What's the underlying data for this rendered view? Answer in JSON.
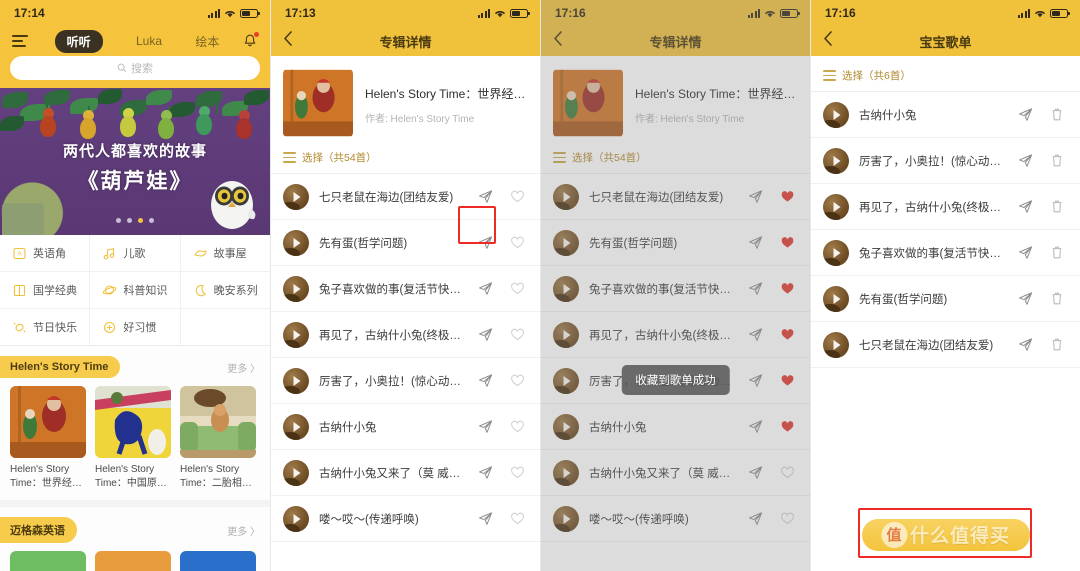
{
  "panels": {
    "home": {
      "status": {
        "time": "17:14"
      },
      "nav": {
        "menu_icon": "hamburger-icon",
        "tabs": [
          {
            "label": "听听",
            "active": true
          },
          {
            "label": "Luka",
            "active": false
          },
          {
            "label": "绘本",
            "active": false
          }
        ],
        "bell_icon": "bell-icon"
      },
      "search": {
        "placeholder": "搜索",
        "icon": "search-icon"
      },
      "hero": {
        "line1": "两代人都喜欢的故事",
        "line2": "《葫芦娃》",
        "dots": 4,
        "active_dot": 2
      },
      "categories": [
        [
          {
            "label": "英语角",
            "icon": "card-icon"
          },
          {
            "label": "儿歌",
            "icon": "music-note-icon"
          },
          {
            "label": "故事屋",
            "icon": "house-icon"
          }
        ],
        [
          {
            "label": "国学经典",
            "icon": "book-icon"
          },
          {
            "label": "科普知识",
            "icon": "planet-icon"
          },
          {
            "label": "晚安系列",
            "icon": "moon-icon"
          }
        ],
        [
          {
            "label": "节日快乐",
            "icon": "candy-icon"
          },
          {
            "label": "好习惯",
            "icon": "plus-circle-icon"
          },
          {
            "label": "",
            "icon": ""
          }
        ]
      ],
      "sections": [
        {
          "tag": "Helen's Story Time",
          "more": "更多 〉",
          "cards": [
            {
              "caption": "Helen's Story Time：世界经…"
            },
            {
              "caption": "Helen's Story Time：中国原…"
            },
            {
              "caption": "Helen's Story Time：二胎相…"
            }
          ]
        },
        {
          "tag": "迈格森英语",
          "more": "更多 〉",
          "cards": [
            {
              "caption": ""
            },
            {
              "caption": ""
            },
            {
              "caption": ""
            }
          ]
        }
      ]
    },
    "album_plain": {
      "status": {
        "time": "17:13"
      },
      "title": "专辑详情",
      "back_icon": "chevron-left-icon",
      "album": {
        "name": "Helen's Story Time：世界经…",
        "author": "作者: Helen's Story Time"
      },
      "select": {
        "label": "选择（共54首）",
        "icon": "list-icon"
      },
      "tracks": [
        {
          "name": "七只老鼠在海边(团结友爱)",
          "fav": false
        },
        {
          "name": "先有蛋(哲学问题)",
          "fav": false
        },
        {
          "name": "兔子喜欢做的事(复活节快…",
          "fav": false
        },
        {
          "name": "再见了，古纳什小兔(终极…",
          "fav": false
        },
        {
          "name": "厉害了，小奥拉！(惊心动…",
          "fav": false
        },
        {
          "name": "古纳什小兔",
          "fav": false
        },
        {
          "name": "古纳什小兔又来了（莫 威…",
          "fav": false
        },
        {
          "name": "喽～哎～(传递呼唤)",
          "fav": false
        }
      ],
      "highlight": "send-icon on first track"
    },
    "album_faved": {
      "status": {
        "time": "17:16"
      },
      "title": "专辑详情",
      "back_icon": "chevron-left-icon",
      "album": {
        "name": "Helen's Story Time：世界经…",
        "author": "作者: Helen's Story Time"
      },
      "select": {
        "label": "选择（共54首）",
        "icon": "list-icon"
      },
      "toast": "收藏到歌单成功",
      "tracks": [
        {
          "name": "七只老鼠在海边(团结友爱)",
          "fav": true
        },
        {
          "name": "先有蛋(哲学问题)",
          "fav": true
        },
        {
          "name": "兔子喜欢做的事(复活节快…",
          "fav": true
        },
        {
          "name": "再见了，古纳什小兔(终极…",
          "fav": true
        },
        {
          "name": "厉害了，小奥拉！(惊心动…",
          "fav": true
        },
        {
          "name": "古纳什小兔",
          "fav": true
        },
        {
          "name": "古纳什小兔又来了（莫 威…",
          "fav": false
        },
        {
          "name": "喽～哎～(传递呼唤)",
          "fav": false
        }
      ]
    },
    "playlist": {
      "status": {
        "time": "17:16"
      },
      "title": "宝宝歌单",
      "back_icon": "chevron-left-icon",
      "select": {
        "label": "选择（共6首）",
        "icon": "list-icon"
      },
      "tracks": [
        {
          "name": "古纳什小兔"
        },
        {
          "name": "厉害了，小奥拉！(惊心动…"
        },
        {
          "name": "再见了，古纳什小兔(终极…"
        },
        {
          "name": "兔子喜欢做的事(复活节快…"
        },
        {
          "name": "先有蛋(哲学问题)"
        },
        {
          "name": "七只老鼠在海边(团结友爱)"
        }
      ],
      "watermark": {
        "badge": "值",
        "text": "什么值得买"
      }
    }
  },
  "colors": {
    "brand_yellow": "#f0c23c",
    "header_yellow": "#f5c43c",
    "hero_purple": "#5b3b79",
    "heart_red": "#de3b31",
    "highlight_red": "#ef2a24"
  }
}
